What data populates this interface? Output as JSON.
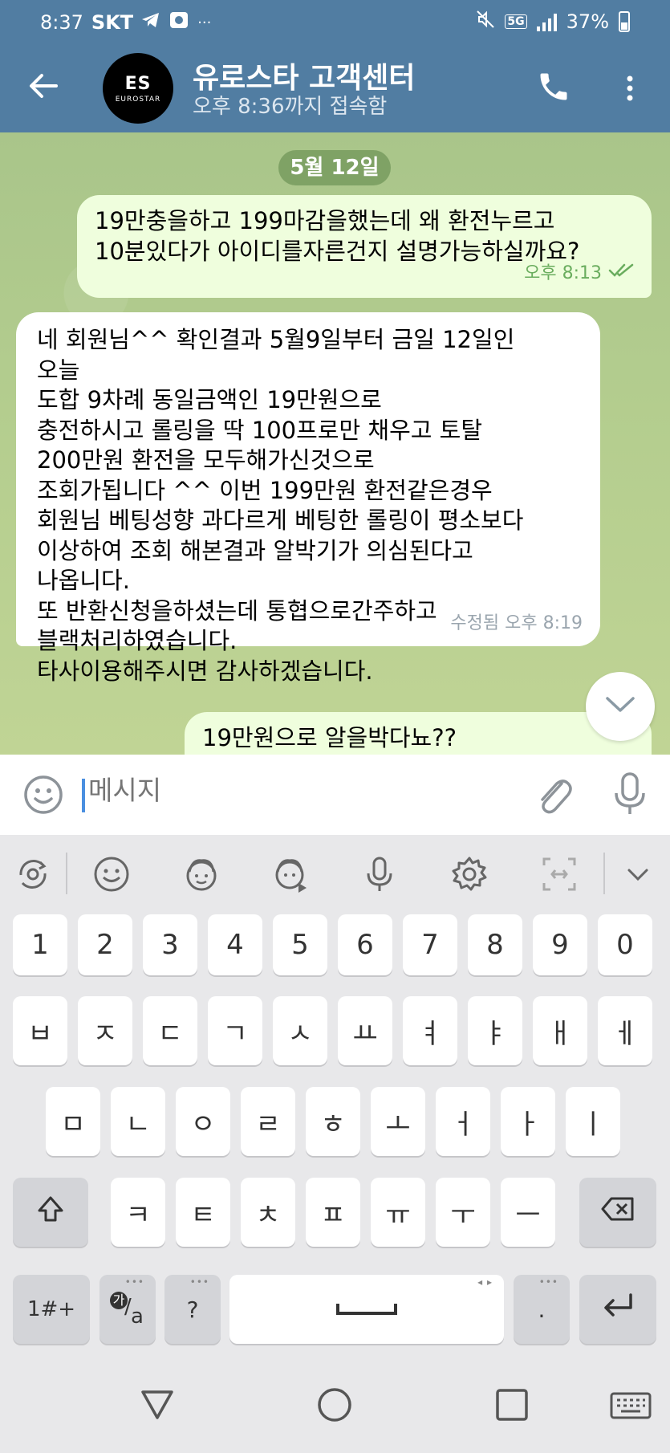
{
  "status_bar": {
    "time": "8:37",
    "carrier": "SKT",
    "network": "5G",
    "battery": "37%",
    "more": "···"
  },
  "header": {
    "title": "유로스타 고객센터",
    "subtitle": "오후 8:36까지 접속함",
    "avatar_logo": "ES",
    "avatar_sub": "EUROSTAR"
  },
  "chat": {
    "date": "5월 12일",
    "messages": [
      {
        "direction": "outgoing",
        "text": "19만충을하고 199마감을했는데 왜 환전누르고\n10분있다가 아이디를자른건지 설명가능하실까요?",
        "time": "오후 8:13",
        "read": true
      },
      {
        "direction": "incoming",
        "text": "네 회원님^^ 확인결과 5월9일부터 금일 12일인\n오늘\n도합 9차례 동일금액인 19만원으로\n충전하시고 롤링을 딱 100프로만 채우고 토탈\n200만원 환전을 모두해가신것으로\n조회가됩니다 ^^ 이번 199만원 환전같은경우\n회원님 베팅성향 과다르게 베팅한 롤링이 평소보다\n이상하여 조회 해본결과 알박기가 의심된다고\n나옵니다.\n또 반환신청을하셨는데 통협으로간주하고\n블랙처리하였습니다.\n타사이용해주시면 감사하겠습니다.",
        "time": "수정됨 오후 8:19"
      },
      {
        "direction": "outgoing",
        "text": "19만원으로 알을박다뇨??"
      }
    ]
  },
  "composer": {
    "placeholder": "메시지"
  },
  "keyboard": {
    "row_numbers": [
      "1",
      "2",
      "3",
      "4",
      "5",
      "6",
      "7",
      "8",
      "9",
      "0"
    ],
    "row1": [
      "ㅂ",
      "ㅈ",
      "ㄷ",
      "ㄱ",
      "ㅅ",
      "ㅛ",
      "ㅕ",
      "ㅑ",
      "ㅐ",
      "ㅔ"
    ],
    "row2": [
      "ㅁ",
      "ㄴ",
      "ㅇ",
      "ㄹ",
      "ㅎ",
      "ㅗ",
      "ㅓ",
      "ㅏ",
      "ㅣ"
    ],
    "row3": [
      "ㅋ",
      "ㅌ",
      "ㅊ",
      "ㅍ",
      "ㅠ",
      "ㅜ",
      "ㅡ"
    ],
    "symbols_label": "1#+",
    "lang_label_top": "가",
    "lang_label_bottom": "a",
    "question_label": "?",
    "period_label": "."
  },
  "colors": {
    "header": "#517da2",
    "outgoing_bubble": "#effedd",
    "incoming_bubble": "#ffffff",
    "check": "#6aad5e"
  }
}
